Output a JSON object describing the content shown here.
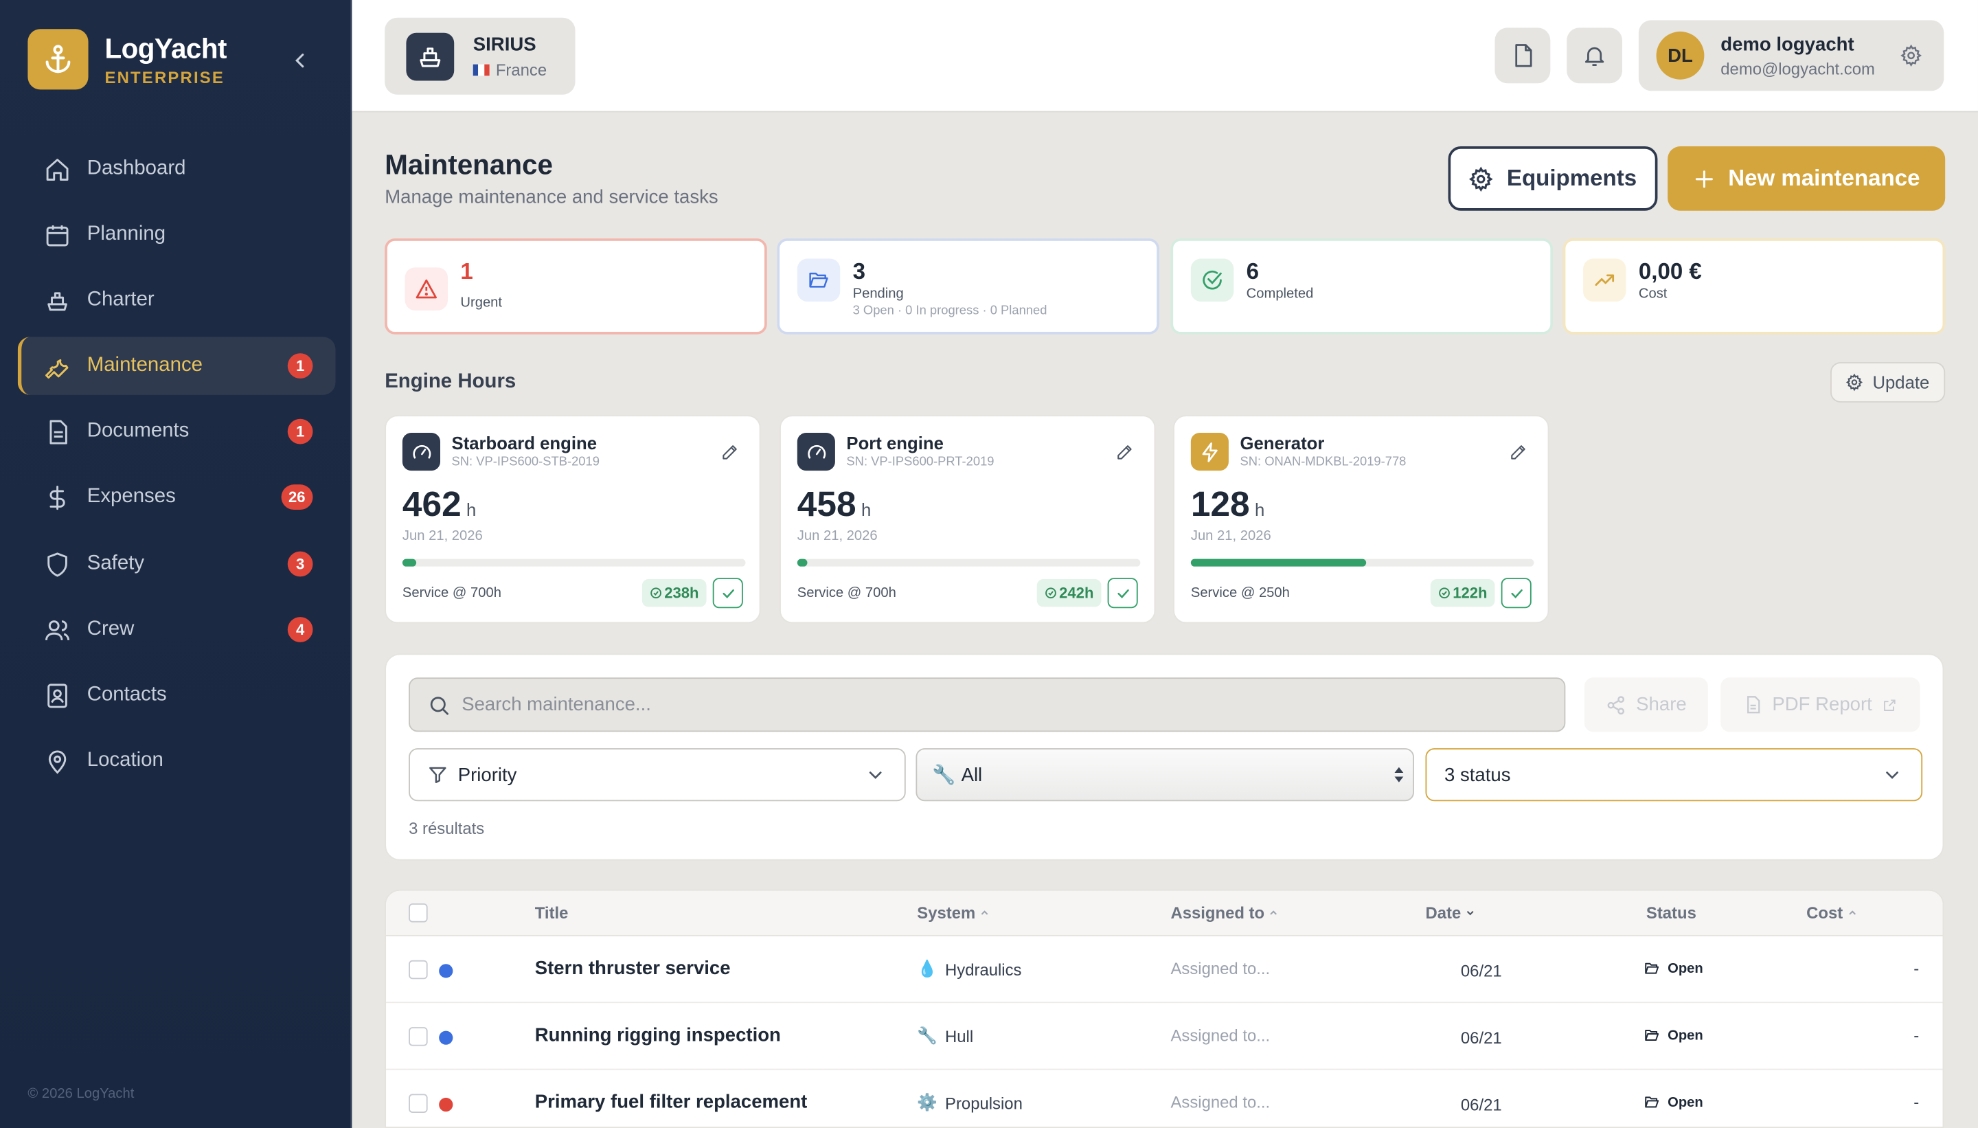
{
  "app": {
    "name": "LogYacht",
    "edition": "ENTERPRISE",
    "copyright": "© 2026 LogYacht"
  },
  "sidebar": {
    "items": [
      {
        "label": "Dashboard",
        "icon": "home-icon",
        "badge": ""
      },
      {
        "label": "Planning",
        "icon": "calendar-icon",
        "badge": ""
      },
      {
        "label": "Charter",
        "icon": "ship-icon",
        "badge": ""
      },
      {
        "label": "Maintenance",
        "icon": "wrench-icon",
        "badge": "1",
        "active": true
      },
      {
        "label": "Documents",
        "icon": "document-icon",
        "badge": "1"
      },
      {
        "label": "Expenses",
        "icon": "dollar-icon",
        "badge": "26"
      },
      {
        "label": "Safety",
        "icon": "shield-icon",
        "badge": "3"
      },
      {
        "label": "Crew",
        "icon": "users-icon",
        "badge": "4"
      },
      {
        "label": "Contacts",
        "icon": "contact-card-icon",
        "badge": ""
      },
      {
        "label": "Location",
        "icon": "map-pin-icon",
        "badge": ""
      }
    ]
  },
  "topbar": {
    "yacht": {
      "name": "SIRIUS",
      "country": "France"
    },
    "user": {
      "initials": "DL",
      "name": "demo logyacht",
      "email": "demo@logyacht.com"
    }
  },
  "header": {
    "title": "Maintenance",
    "subtitle": "Manage maintenance and service tasks",
    "equipments_label": "Equipments",
    "new_label": "New maintenance"
  },
  "stats": {
    "urgent": {
      "value": "1",
      "label": "Urgent"
    },
    "pending": {
      "value": "3",
      "label": "Pending",
      "sub": "3 Open · 0 In progress · 0 Planned"
    },
    "completed": {
      "value": "6",
      "label": "Completed"
    },
    "cost": {
      "value": "0,00 €",
      "label": "Cost"
    }
  },
  "engine_hours": {
    "title": "Engine Hours",
    "update_label": "Update",
    "engines": [
      {
        "name": "Starboard engine",
        "sn": "SN: VP-IPS600-STB-2019",
        "hours": "462",
        "unit": "h",
        "date": "Jun 21, 2026",
        "service": "Service @ 700h",
        "remaining": "238h",
        "progress": 0.04
      },
      {
        "name": "Port engine",
        "sn": "SN: VP-IPS600-PRT-2019",
        "hours": "458",
        "unit": "h",
        "date": "Jun 21, 2026",
        "service": "Service @ 700h",
        "remaining": "242h",
        "progress": 0.03
      },
      {
        "name": "Generator",
        "sn": "SN: ONAN-MDKBL-2019-778",
        "hours": "128",
        "unit": "h",
        "date": "Jun 21, 2026",
        "service": "Service @ 250h",
        "remaining": "122h",
        "progress": 0.51
      }
    ]
  },
  "filters": {
    "search_placeholder": "Search maintenance...",
    "share_label": "Share",
    "pdf_label": "PDF Report",
    "priority_label": "Priority",
    "system_value": "All",
    "status_value": "3 status",
    "results": "3 résultats"
  },
  "table": {
    "headers": {
      "title": "Title",
      "system": "System",
      "assigned": "Assigned to",
      "date": "Date",
      "status": "Status",
      "cost": "Cost"
    },
    "rows": [
      {
        "title": "Stern thruster service",
        "system": "Hydraulics",
        "system_icon": "droplet-icon",
        "assigned": "Assigned to...",
        "date": "06/21",
        "status": "Open",
        "cost": "-",
        "priority_color": "#3b6fe0"
      },
      {
        "title": "Running rigging inspection",
        "system": "Hull",
        "system_icon": "wrench-icon",
        "assigned": "Assigned to...",
        "date": "06/21",
        "status": "Open",
        "cost": "-",
        "priority_color": "#3b6fe0"
      },
      {
        "title": "Primary fuel filter replacement",
        "system": "Propulsion",
        "system_icon": "gear-icon",
        "assigned": "Assigned to...",
        "date": "06/21",
        "status": "Open",
        "cost": "-",
        "priority_color": "#e0453a"
      }
    ]
  },
  "colors": {
    "accent": "#d4a53d",
    "sidebar": "#1d2b45",
    "danger": "#e0453a",
    "success": "#33a06a"
  }
}
